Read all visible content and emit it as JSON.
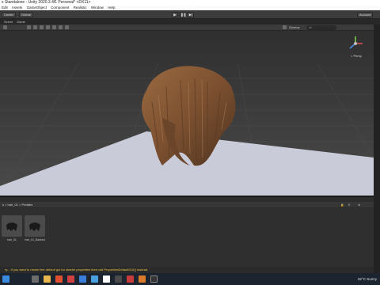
{
  "window": {
    "title": "x Standalone - Unity 2020.3.4f1 Personal* <DX11>"
  },
  "menu": {
    "items": [
      "Edit",
      "Assets",
      "GameObject",
      "Component",
      "Realistic",
      "Window",
      "Help"
    ]
  },
  "toolbar": {
    "center_label": "Center",
    "global_label": "Global",
    "play_glyph": "▶",
    "pause_glyph": "❚❚",
    "step_glyph": "▶|",
    "account_label": "Account"
  },
  "view_tabs": {
    "scene": "Scene",
    "game": "Game"
  },
  "scene_view": {
    "mode_label": "2D",
    "gizmos_label": "Gizmos",
    "search_placeholder": "All",
    "persp_label": "< Persp"
  },
  "project_panel": {
    "breadcrumb": "s > hair_01 > Prefabs",
    "asset_count": "9"
  },
  "assets": [
    {
      "label": "hair_01"
    },
    {
      "label": "hair_01_Bashed"
    }
  ],
  "console": {
    "message": "ry... If you want to render the default gui for shader properties then call PropertiesDefaultGUI() instead."
  },
  "taskbar": {
    "weather": "32°C  Sunny",
    "lang": "ENG"
  },
  "colors": {
    "hair": "#8a5a33",
    "floor": "#c9cbd8",
    "accent": "#e8c543"
  }
}
